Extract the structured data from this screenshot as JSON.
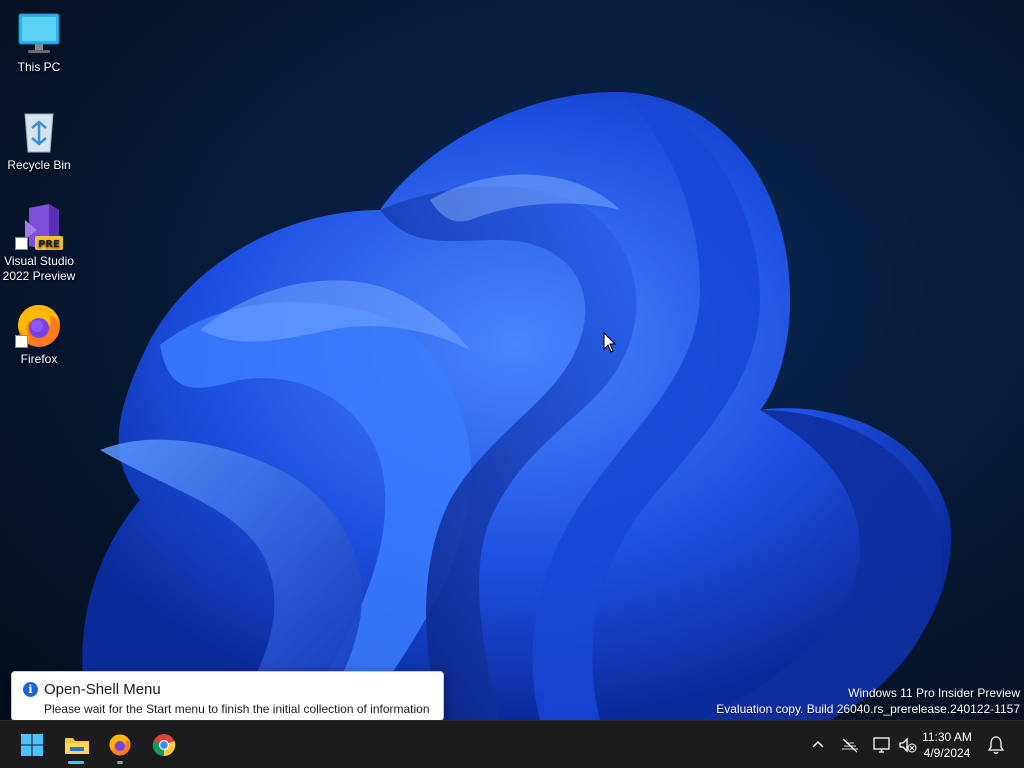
{
  "desktop": {
    "icons": [
      {
        "label": "This PC",
        "icon": "monitor-icon"
      },
      {
        "label": "Recycle Bin",
        "icon": "recycle-bin-icon"
      },
      {
        "label": "Visual Studio 2022 Preview",
        "icon": "visual-studio-preview-icon",
        "badge": "PRE"
      },
      {
        "label": "Firefox",
        "icon": "firefox-icon"
      }
    ]
  },
  "watermark": {
    "line1": "Windows 11 Pro Insider Preview",
    "line2": "Evaluation copy. Build 26040.rs_prerelease.240122-1157"
  },
  "notification": {
    "title": "Open-Shell Menu",
    "message": "Please wait for the Start menu to finish the initial collection of information",
    "icon": "info-icon"
  },
  "taskbar": {
    "pinned": [
      {
        "name": "start-button",
        "icon": "windows-logo-icon"
      },
      {
        "name": "file-explorer-button",
        "icon": "folder-icon",
        "running": true
      },
      {
        "name": "firefox-taskbar-button",
        "icon": "firefox-icon",
        "running": true
      },
      {
        "name": "chrome-taskbar-button",
        "icon": "chrome-icon",
        "running": false
      }
    ],
    "tray": {
      "icons": [
        "chevron-up-icon",
        "no-network-icon",
        "network-display-icon",
        "volume-muted-icon",
        "notification-bell-icon"
      ],
      "time": "11:30 AM",
      "date": "4/9/2024"
    }
  },
  "colors": {
    "accent": "#4cc2ff",
    "taskbar": "#1c1c1c",
    "wallpaper_dark": "#061429",
    "bloom_blue": "#1f5fff"
  }
}
